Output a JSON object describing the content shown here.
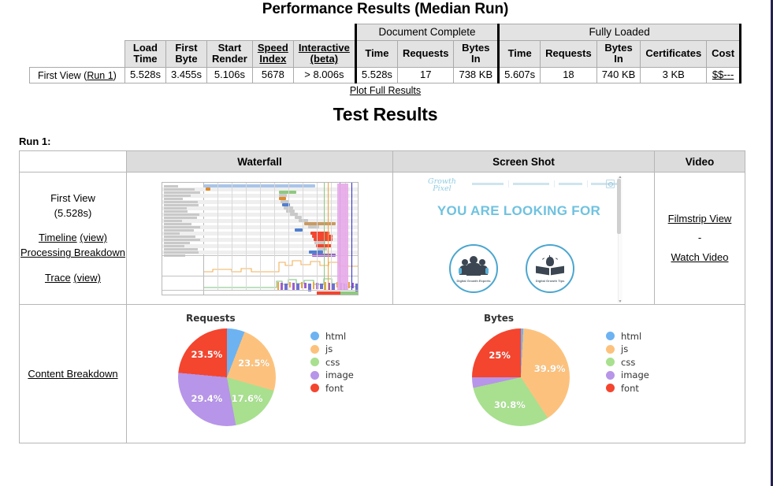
{
  "perf": {
    "title": "Performance Results (Median Run)",
    "group_headers": [
      "Document Complete",
      "Fully Loaded"
    ],
    "columns": [
      "Load Time",
      "First Byte",
      "Start Render",
      "Speed Index",
      "Interactive (beta)",
      "Time",
      "Requests",
      "Bytes In",
      "Time",
      "Requests",
      "Bytes In",
      "Certificates",
      "Cost"
    ],
    "columns_split": [
      [
        "Load",
        "Time"
      ],
      [
        "First",
        "Byte"
      ],
      [
        "Start",
        "Render"
      ],
      [
        "Speed",
        "Index"
      ],
      [
        "Interactive",
        "(beta)"
      ],
      [
        "Time",
        ""
      ],
      [
        "Requests",
        ""
      ],
      [
        "Bytes",
        "In"
      ],
      [
        "Time",
        ""
      ],
      [
        "Requests",
        ""
      ],
      [
        "Bytes",
        "In"
      ],
      [
        "Certificates",
        ""
      ],
      [
        "Cost",
        ""
      ]
    ],
    "row_label_prefix": "First View (",
    "row_label_link": "Run 1",
    "row_label_suffix": ")",
    "values": [
      "5.528s",
      "3.455s",
      "5.106s",
      "5678",
      "> 8.006s",
      "5.528s",
      "17",
      "738 KB",
      "5.607s",
      "18",
      "740 KB",
      "3 KB"
    ],
    "cost": "$$---",
    "plot_full_results": "Plot Full Results"
  },
  "test_results": {
    "title": "Test Results",
    "run_label": "Run 1:",
    "headers": [
      "Waterfall",
      "Screen Shot",
      "Video"
    ],
    "first_view": {
      "line1": "First View",
      "line2": "(5.528s)",
      "timeline": "Timeline",
      "timeline_view": "(view)",
      "processing_breakdown": "Processing Breakdown",
      "trace": "Trace",
      "trace_view": "(view)"
    },
    "video": {
      "filmstrip": "Filmstrip View",
      "separator": "-",
      "watch": "Watch Video"
    },
    "content_breakdown_label": "Content Breakdown"
  },
  "screenshot_thumb": {
    "logo_line1": "Growth",
    "logo_line2": "Pixel",
    "headline": "YOU ARE LOOKING FOR",
    "caption_left": "Digital Growth Experts",
    "caption_right": "Digital Growth Tips"
  },
  "colors": {
    "html": "#6db3f2",
    "js": "#fcc27d",
    "css": "#a8e08f",
    "image": "#b795e8",
    "font": "#f4452f",
    "header_bg": "#e3e3e3",
    "results_header_bg": "#dcdcdc",
    "accent_blue": "#6fc2e0"
  },
  "chart_data": [
    {
      "type": "pie",
      "title": "Requests",
      "categories": [
        "html",
        "js",
        "css",
        "image",
        "font"
      ],
      "values": [
        5.9,
        23.5,
        17.6,
        29.4,
        23.5
      ],
      "unit": "%",
      "labels": [
        "",
        "23.5%",
        "17.6%",
        "29.4%",
        "23.5%"
      ],
      "colors": [
        "#6db3f2",
        "#fcc27d",
        "#a8e08f",
        "#b795e8",
        "#f4452f"
      ],
      "legend_position": "right",
      "grid": false
    },
    {
      "type": "pie",
      "title": "Bytes",
      "categories": [
        "html",
        "js",
        "css",
        "image",
        "font"
      ],
      "values": [
        0.8,
        39.9,
        30.8,
        3.5,
        25.0
      ],
      "unit": "%",
      "labels": [
        "",
        "39.9%",
        "30.8%",
        "",
        "25%"
      ],
      "colors": [
        "#6db3f2",
        "#fcc27d",
        "#a8e08f",
        "#b795e8",
        "#f4452f"
      ],
      "legend_position": "right",
      "grid": false
    }
  ]
}
